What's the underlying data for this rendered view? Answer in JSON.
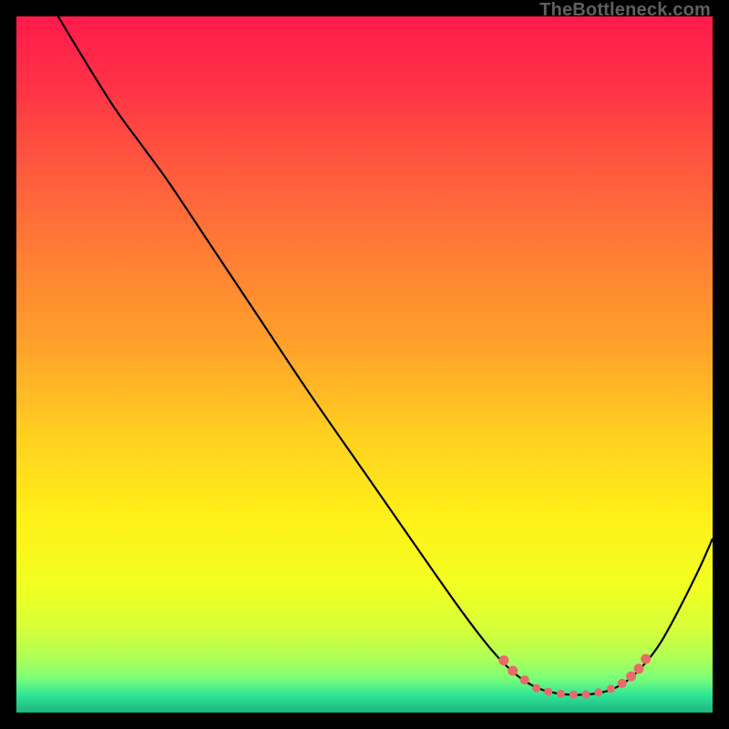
{
  "watermark": "TheBottleneck.com",
  "colors": {
    "black": "#000000",
    "marker": "#e86a6a",
    "curve": "#000000"
  },
  "chart_data": {
    "type": "line",
    "title": "",
    "xlabel": "",
    "ylabel": "",
    "xlim": [
      0,
      100
    ],
    "ylim": [
      0,
      100
    ],
    "gradient_stops": [
      {
        "offset": 0.0,
        "color": "#ff1a4b"
      },
      {
        "offset": 0.1,
        "color": "#ff3246"
      },
      {
        "offset": 0.22,
        "color": "#ff5a3e"
      },
      {
        "offset": 0.35,
        "color": "#ff8034"
      },
      {
        "offset": 0.48,
        "color": "#ffa42a"
      },
      {
        "offset": 0.6,
        "color": "#ffcf20"
      },
      {
        "offset": 0.72,
        "color": "#fff018"
      },
      {
        "offset": 0.82,
        "color": "#f2ff22"
      },
      {
        "offset": 0.88,
        "color": "#d6ff3a"
      },
      {
        "offset": 0.92,
        "color": "#b0ff55"
      },
      {
        "offset": 0.95,
        "color": "#7dff77"
      },
      {
        "offset": 0.975,
        "color": "#30e597"
      },
      {
        "offset": 1.0,
        "color": "#1db47f"
      }
    ],
    "curve": [
      {
        "x": 6.0,
        "y": 100.0
      },
      {
        "x": 9.0,
        "y": 95.0
      },
      {
        "x": 14.0,
        "y": 87.0
      },
      {
        "x": 18.0,
        "y": 81.5
      },
      {
        "x": 22.0,
        "y": 76.0
      },
      {
        "x": 28.0,
        "y": 67.0
      },
      {
        "x": 35.0,
        "y": 56.5
      },
      {
        "x": 42.0,
        "y": 46.0
      },
      {
        "x": 50.0,
        "y": 34.5
      },
      {
        "x": 58.0,
        "y": 23.0
      },
      {
        "x": 64.0,
        "y": 14.5
      },
      {
        "x": 68.0,
        "y": 9.3
      },
      {
        "x": 70.5,
        "y": 6.6
      },
      {
        "x": 72.5,
        "y": 4.9
      },
      {
        "x": 74.5,
        "y": 3.7
      },
      {
        "x": 76.5,
        "y": 3.0
      },
      {
        "x": 79.0,
        "y": 2.6
      },
      {
        "x": 82.0,
        "y": 2.6
      },
      {
        "x": 84.5,
        "y": 3.0
      },
      {
        "x": 86.5,
        "y": 3.8
      },
      {
        "x": 88.5,
        "y": 5.2
      },
      {
        "x": 90.5,
        "y": 7.3
      },
      {
        "x": 92.5,
        "y": 10.0
      },
      {
        "x": 95.0,
        "y": 14.5
      },
      {
        "x": 98.0,
        "y": 20.5
      },
      {
        "x": 100.0,
        "y": 25.0
      }
    ],
    "markers": [
      {
        "x": 70.0,
        "y": 7.5,
        "r": 5.5
      },
      {
        "x": 71.3,
        "y": 6.0,
        "r": 5.5
      },
      {
        "x": 73.0,
        "y": 4.7,
        "r": 5.0
      },
      {
        "x": 74.7,
        "y": 3.5,
        "r": 4.5
      },
      {
        "x": 76.4,
        "y": 3.0,
        "r": 4.5
      },
      {
        "x": 78.2,
        "y": 2.7,
        "r": 4.5
      },
      {
        "x": 80.0,
        "y": 2.6,
        "r": 4.5
      },
      {
        "x": 81.8,
        "y": 2.6,
        "r": 4.5
      },
      {
        "x": 83.6,
        "y": 2.9,
        "r": 4.5
      },
      {
        "x": 85.4,
        "y": 3.4,
        "r": 4.5
      },
      {
        "x": 87.0,
        "y": 4.2,
        "r": 5.0
      },
      {
        "x": 88.3,
        "y": 5.2,
        "r": 5.5
      },
      {
        "x": 89.4,
        "y": 6.3,
        "r": 5.5
      },
      {
        "x": 90.4,
        "y": 7.7,
        "r": 5.5
      }
    ]
  }
}
